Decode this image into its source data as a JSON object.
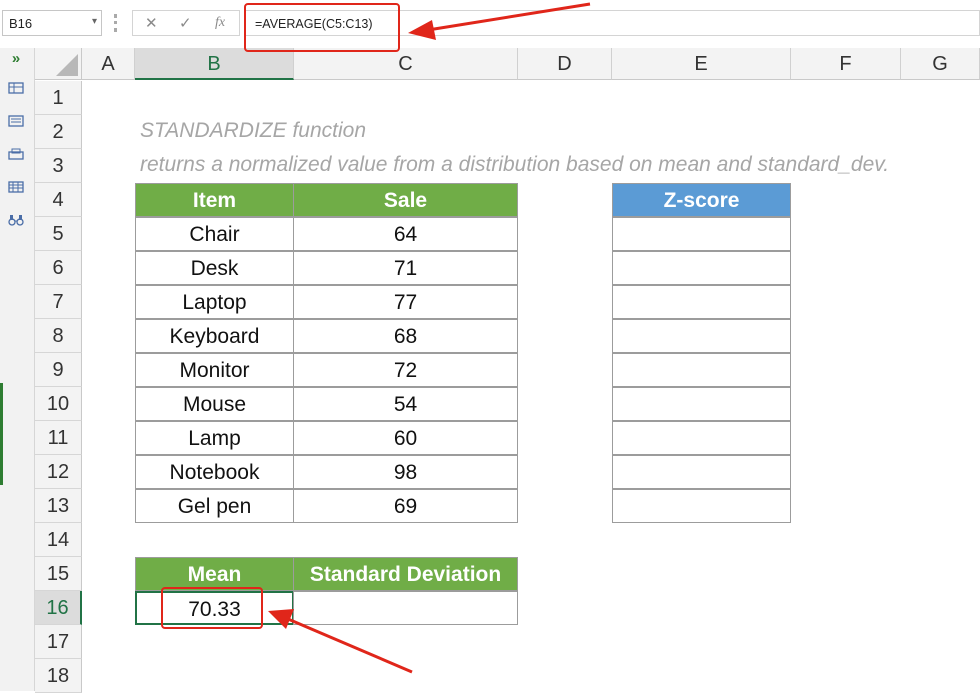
{
  "formula_bar": {
    "name_box": "B16",
    "name_box_arrow": "▾",
    "cancel_icon": "✕",
    "enter_icon": "✓",
    "fx_label": "fx",
    "formula": "=AVERAGE(C5:C13)"
  },
  "left_toolbar": {
    "expand": "»",
    "icons": [
      "table-icon",
      "list-icon",
      "print-icon",
      "grid-icon",
      "binoculars-icon"
    ]
  },
  "columns": [
    "A",
    "B",
    "C",
    "D",
    "E",
    "F",
    "G"
  ],
  "selected_column": "B",
  "rows": [
    "1",
    "2",
    "3",
    "4",
    "5",
    "6",
    "7",
    "8",
    "9",
    "10",
    "11",
    "12",
    "13",
    "14",
    "15",
    "16",
    "17",
    "18"
  ],
  "selected_row": "16",
  "sheet": {
    "title_line": "STANDARDIZE  function",
    "description_line": "returns a normalized value from a distribution based on mean and standard_dev.",
    "table_headers": {
      "item": "Item",
      "sale": "Sale",
      "zscore": "Z-score"
    },
    "items": [
      {
        "item": "Chair",
        "sale": "64"
      },
      {
        "item": "Desk",
        "sale": "71"
      },
      {
        "item": "Laptop",
        "sale": "77"
      },
      {
        "item": "Keyboard",
        "sale": "68"
      },
      {
        "item": "Monitor",
        "sale": "72"
      },
      {
        "item": "Mouse",
        "sale": "54"
      },
      {
        "item": "Lamp",
        "sale": "60"
      },
      {
        "item": "Notebook",
        "sale": "98"
      },
      {
        "item": "Gel pen",
        "sale": "69"
      }
    ],
    "stats_headers": {
      "mean": "Mean",
      "std": "Standard Deviation"
    },
    "mean_value": "70.33",
    "std_value": ""
  },
  "colors": {
    "green_header": "#70ad47",
    "blue_header": "#5b9bd5",
    "annotation_red": "#e0261a",
    "excel_green": "#217346"
  }
}
